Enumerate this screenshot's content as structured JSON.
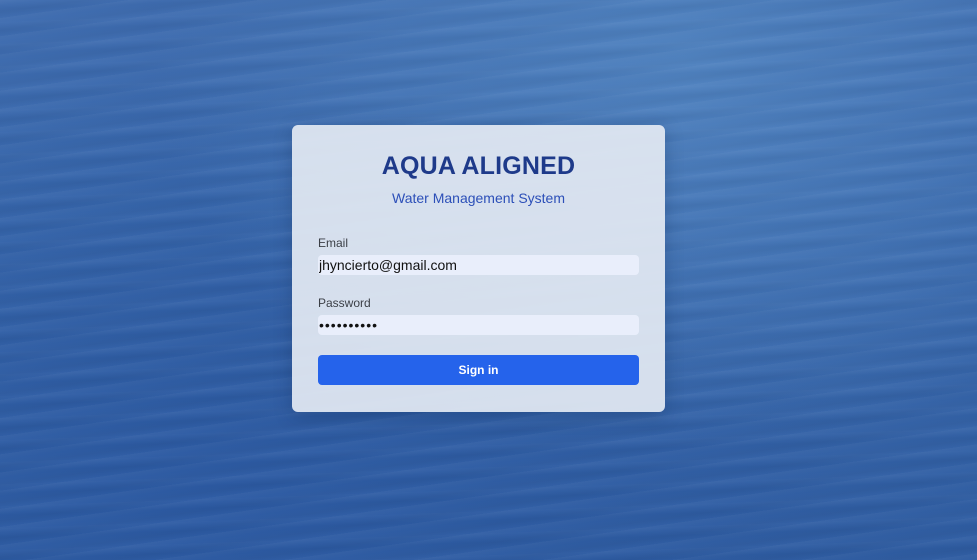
{
  "brand": {
    "title": "AQUA ALIGNED",
    "subtitle": "Water Management System"
  },
  "form": {
    "email_label": "Email",
    "email_value": "jhyncierto@gmail.com",
    "password_label": "Password",
    "password_value": "jhyncierto",
    "submit_label": "Sign in"
  },
  "colors": {
    "background": "#3868ad",
    "card": "#e2e8f2",
    "title": "#1e3a8a",
    "subtitle": "#2c4fb8",
    "input": "#e9eefb",
    "button": "#2563eb"
  }
}
